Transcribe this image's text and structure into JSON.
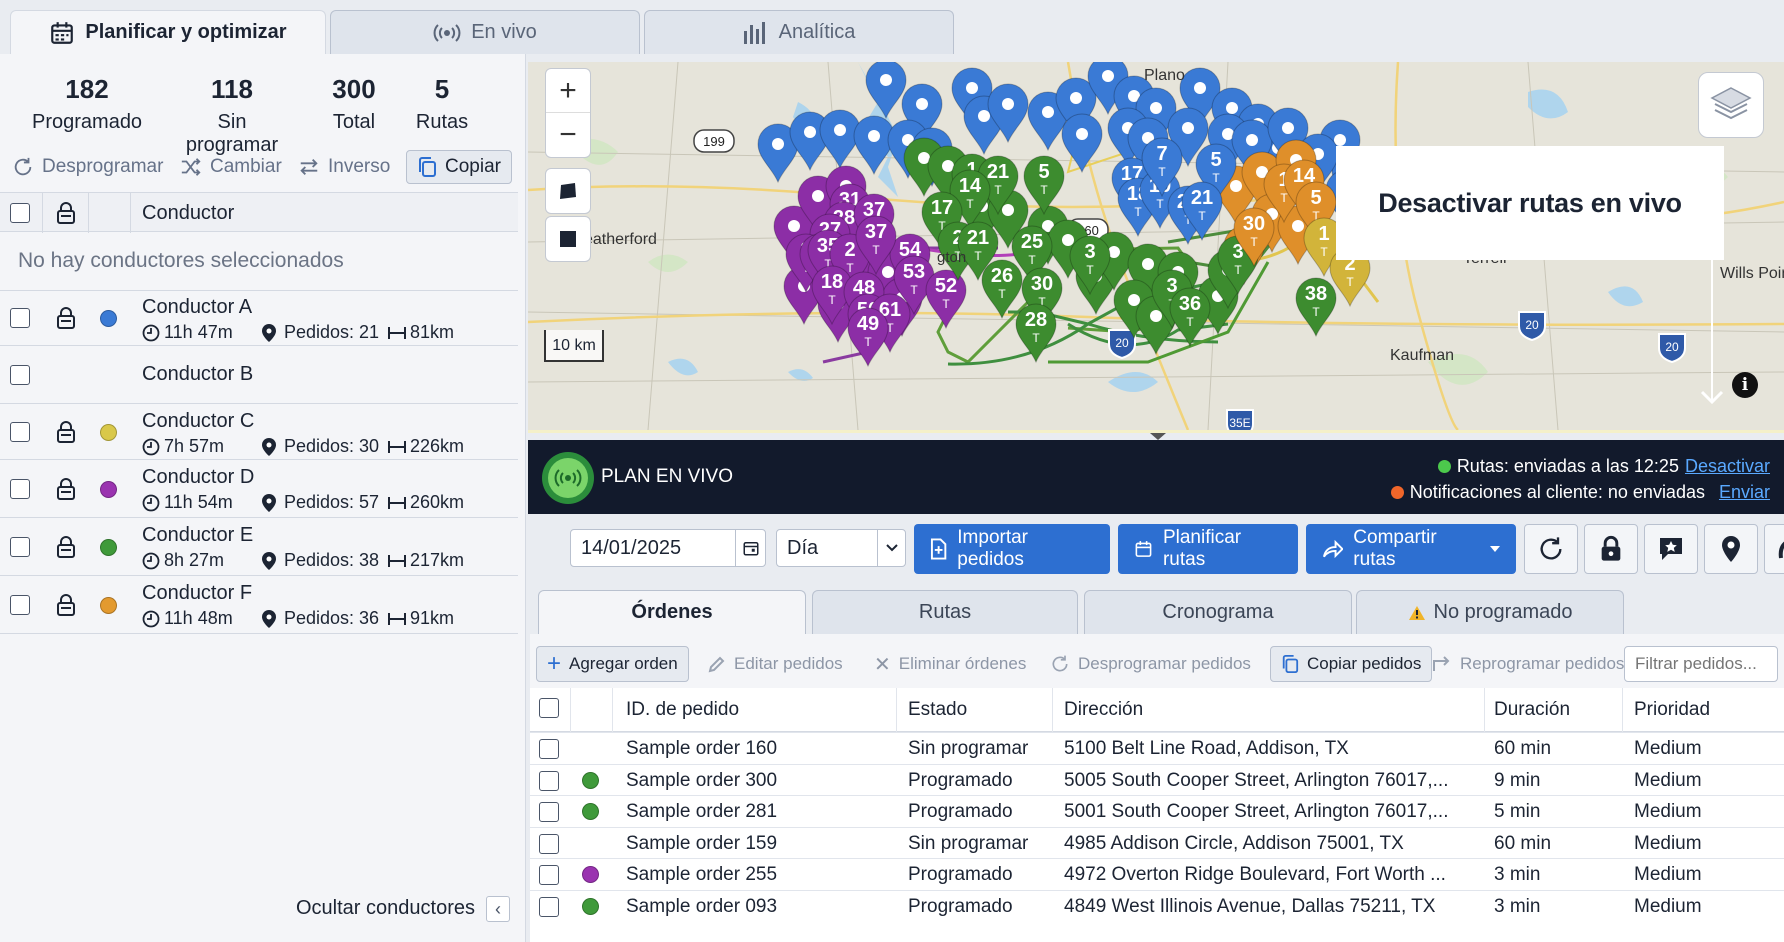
{
  "tabs": [
    {
      "label": "Planificar y optimizar"
    },
    {
      "label": "En vivo"
    },
    {
      "label": "Analítica"
    }
  ],
  "stats": [
    {
      "value": "182",
      "label": "Programado"
    },
    {
      "value": "118",
      "label": "Sin programar"
    },
    {
      "value": "300",
      "label": "Total"
    },
    {
      "value": "5",
      "label": "Rutas"
    }
  ],
  "actions": {
    "unschedule": "Desprogramar",
    "swap": "Cambiar",
    "reverse": "Inverso",
    "copy": "Copiar"
  },
  "drivers_header": "Conductor",
  "no_selection": "No hay conductores seleccionados",
  "drivers": [
    {
      "name": "Conductor A",
      "time": "11h 47m",
      "orders": "Pedidos: 21",
      "distance": "81km",
      "color": "#3a7ad5"
    },
    {
      "name": "Conductor B"
    },
    {
      "name": "Conductor C",
      "time": "7h 57m",
      "orders": "Pedidos: 30",
      "distance": "226km",
      "color": "#d9c84a"
    },
    {
      "name": "Conductor D",
      "time": "11h 54m",
      "orders": "Pedidos: 57",
      "distance": "260km",
      "color": "#9a33b0"
    },
    {
      "name": "Conductor E",
      "time": "8h 27m",
      "orders": "Pedidos: 38",
      "distance": "217km",
      "color": "#3f9a3a"
    },
    {
      "name": "Conductor F",
      "time": "11h 48m",
      "orders": "Pedidos: 36",
      "distance": "91km",
      "color": "#e39a2f"
    }
  ],
  "hide_drivers": "Ocultar conductores",
  "map": {
    "zoom_in": "+",
    "zoom_out": "−",
    "scale": "10 km",
    "tooltip": "Desactivar rutas en vivo",
    "labels": {
      "plano": "Plano",
      "weatherford": "eatherford",
      "terrell": "Terrell",
      "kaufman": "Kaufman",
      "wills_point": "Wills Poin",
      "arlington": "gton",
      "hwy199": "199",
      "hwy360": "360",
      "i20a": "20",
      "i20b": "20",
      "i20c": "20",
      "i20d": "20",
      "i35e": "35E"
    },
    "pins": {
      "purple": [
        "31",
        "28",
        "37",
        "27",
        "3",
        "3",
        "35",
        "2",
        "54",
        "37",
        "18",
        "48",
        "53",
        "52",
        "50",
        "61",
        "49"
      ],
      "green": [
        "1",
        "21",
        "5",
        "14",
        "17",
        "2",
        "21",
        "25",
        "3",
        "26",
        "30",
        "28",
        "3",
        "36",
        "3",
        "38"
      ],
      "blue": [
        "17",
        "18",
        "19",
        "7",
        "5",
        "20",
        "21",
        "1"
      ],
      "orange": [
        "1",
        "14",
        "5",
        "30"
      ],
      "yellow": [
        "1",
        "2"
      ]
    }
  },
  "live_plan": {
    "title": "PLAN EN VIVO",
    "routes_status": "Rutas: enviadas a las 12:25",
    "deactivate": "Desactivar",
    "notifications_status": "Notificaciones al cliente: no enviadas",
    "send": "Enviar",
    "status_colors": {
      "routes": "#4cc94c",
      "notifications": "#f0662a"
    }
  },
  "toolbar": {
    "date": "14/01/2025",
    "period": "Día",
    "import": "Importar pedidos",
    "plan": "Planificar rutas",
    "share": "Compartir rutas"
  },
  "subtabs": [
    "Órdenes",
    "Rutas",
    "Cronograma",
    "No programado"
  ],
  "table_actions": {
    "add": "Agregar orden",
    "edit": "Editar pedidos",
    "delete": "Eliminar órdenes",
    "unschedule": "Desprogramar pedidos",
    "copy": "Copiar pedidos",
    "reschedule": "Reprogramar pedidos",
    "filter_placeholder": "Filtrar pedidos..."
  },
  "table": {
    "columns": [
      "ID. de pedido",
      "Estado",
      "Dirección",
      "Duración",
      "Prioridad"
    ],
    "rows": [
      {
        "id": "Sample order 160",
        "status": "Sin programar",
        "address": "5100 Belt Line Road, Addison, TX",
        "duration": "60 min",
        "priority": "Medium",
        "color": ""
      },
      {
        "id": "Sample order 300",
        "status": "Programado",
        "address": "5005 South Cooper Street, Arlington 76017,...",
        "duration": "9 min",
        "priority": "Medium",
        "color": "#3f9a3a"
      },
      {
        "id": "Sample order 281",
        "status": "Programado",
        "address": "5001 South Cooper Street, Arlington 76017,...",
        "duration": "5 min",
        "priority": "Medium",
        "color": "#3f9a3a"
      },
      {
        "id": "Sample order 159",
        "status": "Sin programar",
        "address": "4985 Addison Circle, Addison 75001, TX",
        "duration": "60 min",
        "priority": "Medium",
        "color": ""
      },
      {
        "id": "Sample order 255",
        "status": "Programado",
        "address": "4972 Overton Ridge Boulevard, Fort Worth ...",
        "duration": "3 min",
        "priority": "Medium",
        "color": "#9a33b0"
      },
      {
        "id": "Sample order 093",
        "status": "Programado",
        "address": "4849 West Illinois Avenue, Dallas 75211, TX",
        "duration": "3 min",
        "priority": "Medium",
        "color": "#3f9a3a"
      }
    ]
  }
}
